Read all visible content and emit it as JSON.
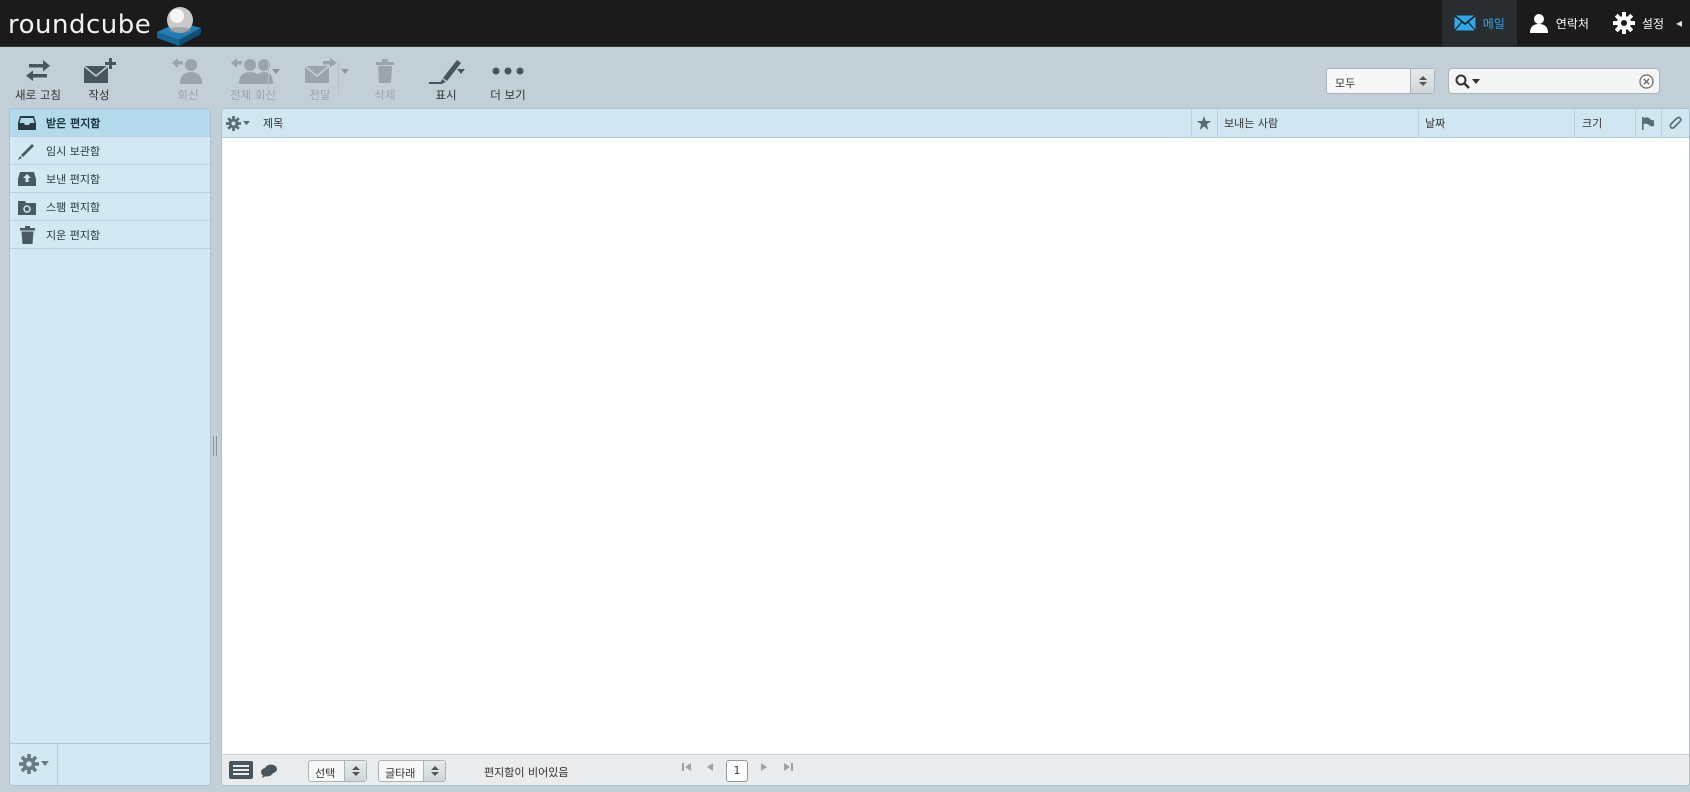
{
  "app": {
    "logo_text": "roundcube"
  },
  "taskbar": {
    "mail": "메일",
    "contacts": "연락처",
    "settings": "설정"
  },
  "toolbar": {
    "refresh": "새로 고침",
    "compose": "작성",
    "reply": "회신",
    "reply_all": "전체 회신",
    "forward": "전달",
    "delete": "삭제",
    "mark": "표시",
    "more": "더 보기"
  },
  "filter": {
    "selected": "모두"
  },
  "search": {
    "value": "",
    "placeholder": ""
  },
  "folders": [
    {
      "label": "받은 편지함",
      "icon": "inbox-icon",
      "selected": true
    },
    {
      "label": "임시 보관함",
      "icon": "pencil-icon",
      "selected": false
    },
    {
      "label": "보낸 편지함",
      "icon": "sent-icon",
      "selected": false
    },
    {
      "label": "스팸 편지함",
      "icon": "junk-icon",
      "selected": false
    },
    {
      "label": "지운 편지함",
      "icon": "trash-icon",
      "selected": false
    }
  ],
  "list_columns": {
    "subject": "제목",
    "from": "보내는 사람",
    "date": "날짜",
    "size": "크기"
  },
  "list_footer": {
    "select_label": "선택",
    "threads_label": "글타래",
    "status": "편지함이 비어있음",
    "page": "1"
  },
  "colors": {
    "topbar": "#1b1b1b",
    "accent": "#2fa8e8",
    "background": "#c3cfd6",
    "pane": "#d2e8f2",
    "selected_folder": "#b4d9ea"
  }
}
